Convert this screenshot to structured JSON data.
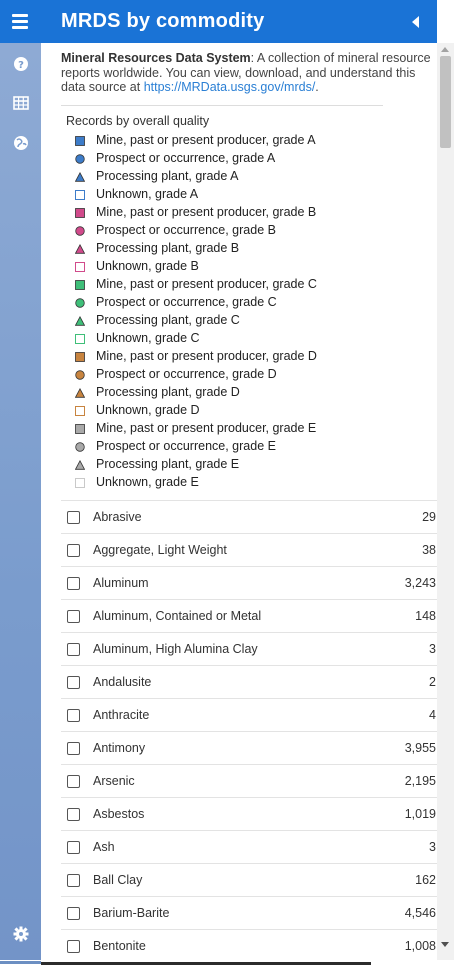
{
  "header": {
    "title": "MRDS by commodity"
  },
  "sidebar": {
    "icons": [
      "help-icon",
      "table-icon",
      "globe-icon",
      "settings-icon"
    ]
  },
  "description": {
    "bold": "Mineral Resources Data System",
    "text": ": A collection of mineral resource reports worldwide. You can view, download, and understand this data source at ",
    "link": "https://MRData.usgs.gov/mrds/",
    "end": "."
  },
  "legend": {
    "title": "Records by overall quality",
    "items": [
      {
        "label": "Mine, past or present producer, grade A",
        "shape": "square",
        "color": "#3d7cc9"
      },
      {
        "label": "Prospect or occurrence, grade A",
        "shape": "circle",
        "color": "#3d7cc9"
      },
      {
        "label": "Processing plant, grade A",
        "shape": "triangle",
        "color": "#3d7cc9"
      },
      {
        "label": "Unknown, grade A",
        "shape": "open",
        "color": "#3d7cc9"
      },
      {
        "label": "Mine, past or present producer, grade B",
        "shape": "square",
        "color": "#d14a8b"
      },
      {
        "label": "Prospect or occurrence, grade B",
        "shape": "circle",
        "color": "#d14a8b"
      },
      {
        "label": "Processing plant, grade B",
        "shape": "triangle",
        "color": "#d14a8b"
      },
      {
        "label": "Unknown, grade B",
        "shape": "open",
        "color": "#d14a8b"
      },
      {
        "label": "Mine, past or present producer, grade C",
        "shape": "square",
        "color": "#3fbf79"
      },
      {
        "label": "Prospect or occurrence, grade C",
        "shape": "circle",
        "color": "#3fbf79"
      },
      {
        "label": "Processing plant, grade C",
        "shape": "triangle",
        "color": "#3fbf79"
      },
      {
        "label": "Unknown, grade C",
        "shape": "open",
        "color": "#3fbf79"
      },
      {
        "label": "Mine, past or present producer, grade D",
        "shape": "square",
        "color": "#c8843f"
      },
      {
        "label": "Prospect or occurrence, grade D",
        "shape": "circle",
        "color": "#c8843f"
      },
      {
        "label": "Processing plant, grade D",
        "shape": "triangle",
        "color": "#c8843f"
      },
      {
        "label": "Unknown, grade D",
        "shape": "open",
        "color": "#c8843f"
      },
      {
        "label": "Mine, past or present producer, grade E",
        "shape": "square",
        "color": "#a9a9a9"
      },
      {
        "label": "Prospect or occurrence, grade E",
        "shape": "circle",
        "color": "#a9a9a9"
      },
      {
        "label": "Processing plant, grade E",
        "shape": "triangle",
        "color": "#a9a9a9"
      },
      {
        "label": "Unknown, grade E",
        "shape": "open",
        "color": "#c9c9c9"
      }
    ]
  },
  "commodities": [
    {
      "name": "Abrasive",
      "count": "29"
    },
    {
      "name": "Aggregate, Light Weight",
      "count": "38"
    },
    {
      "name": "Aluminum",
      "count": "3,243"
    },
    {
      "name": "Aluminum, Contained or Metal",
      "count": "148"
    },
    {
      "name": "Aluminum, High Alumina Clay",
      "count": "3"
    },
    {
      "name": "Andalusite",
      "count": "2"
    },
    {
      "name": "Anthracite",
      "count": "4"
    },
    {
      "name": "Antimony",
      "count": "3,955"
    },
    {
      "name": "Arsenic",
      "count": "2,195"
    },
    {
      "name": "Asbestos",
      "count": "1,019"
    },
    {
      "name": "Ash",
      "count": "3"
    },
    {
      "name": "Ball Clay",
      "count": "162"
    },
    {
      "name": "Barium-Barite",
      "count": "4,546"
    },
    {
      "name": "Bentonite",
      "count": "1,008"
    }
  ],
  "colors": {
    "header": "#1a73d6",
    "sidebar": "#7a9ccd",
    "link": "#2a7fd4"
  }
}
